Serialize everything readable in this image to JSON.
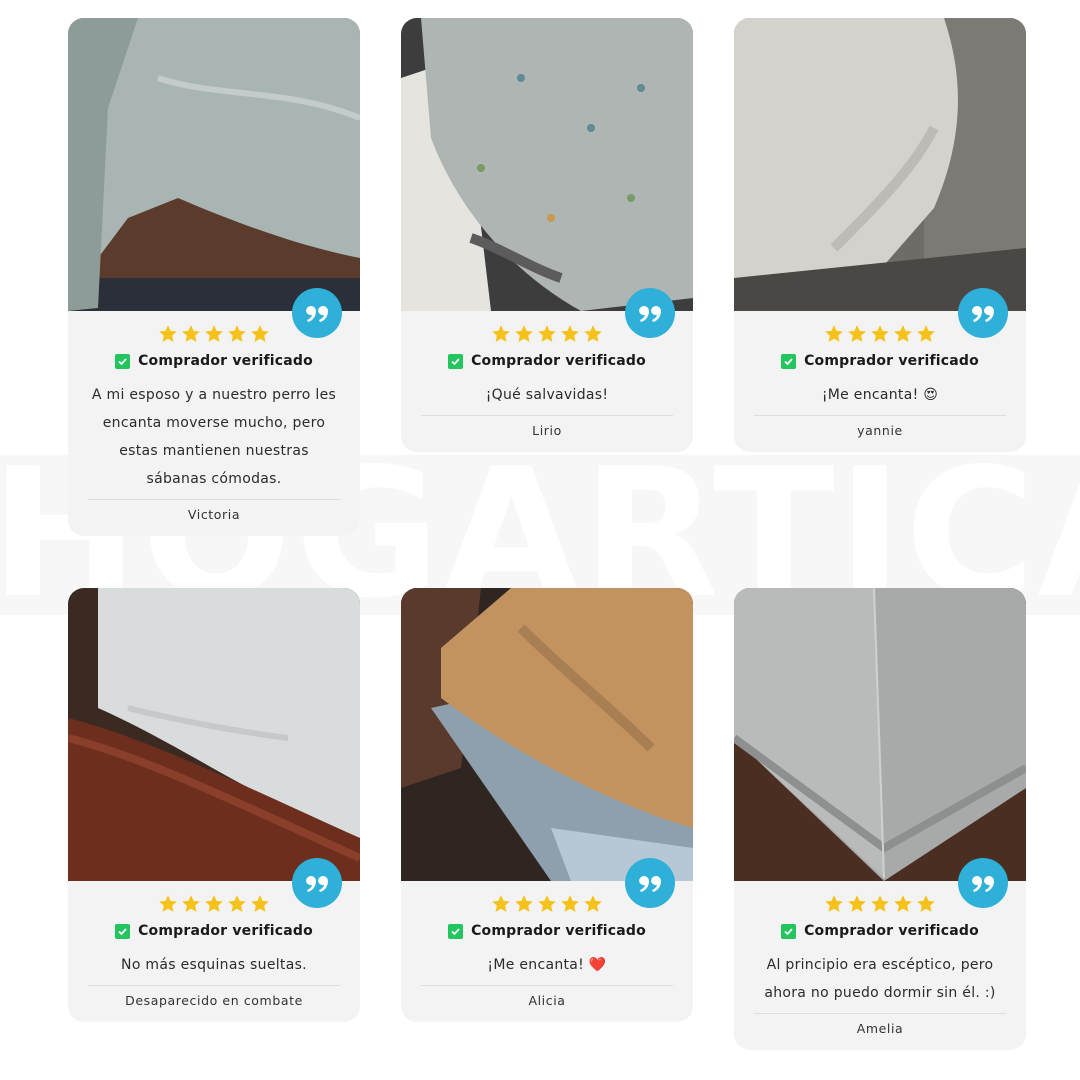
{
  "watermark": "HOGARTICA",
  "colors": {
    "accent": "#2fb0d8",
    "star": "#f5c21b",
    "verified": "#22c55e",
    "card": "#f3f3f3"
  },
  "icons": {
    "quote": "quote-icon",
    "star": "star-icon",
    "check": "checkbox-check-icon"
  },
  "reviews": [
    {
      "rating": 5,
      "verified_label": "Comprador verificado",
      "text": "A mi esposo y a nuestro perro les encanta moverse mucho, pero estas mantienen nuestras sábanas cómodas.",
      "author": "Victoria"
    },
    {
      "rating": 5,
      "verified_label": "Comprador verificado",
      "text": "¡Qué salvavidas!",
      "author": "Lirio"
    },
    {
      "rating": 5,
      "verified_label": "Comprador verificado",
      "text": "¡Me encanta! 😍",
      "author": "yannie"
    },
    {
      "rating": 5,
      "verified_label": "Comprador verificado",
      "text": "No más esquinas sueltas.",
      "author": "Desaparecido en combate"
    },
    {
      "rating": 5,
      "verified_label": "Comprador verificado",
      "text": "¡Me encanta! ❤️",
      "author": "Alicia"
    },
    {
      "rating": 5,
      "verified_label": "Comprador verificado",
      "text": "Al principio era escéptico, pero ahora no puedo dormir sin él. :)",
      "author": "Amelia"
    }
  ]
}
